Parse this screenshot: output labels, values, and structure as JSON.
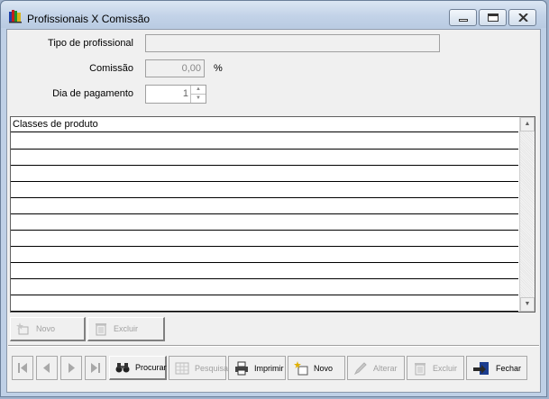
{
  "window": {
    "title": "Profissionais X Comissão",
    "controls": [
      "minimize",
      "maximize",
      "close"
    ]
  },
  "form": {
    "tipo_label": "Tipo de profissional",
    "tipo_value": "",
    "comissao_label": "Comissão",
    "comissao_value": "0,00",
    "comissao_unit": "%",
    "dia_label": "Dia de pagamento",
    "dia_value": "1"
  },
  "grid": {
    "header": "Classes de produto",
    "rows": [
      "",
      "",
      "",
      "",
      "",
      "",
      "",
      "",
      "",
      "",
      ""
    ]
  },
  "grid_buttons": {
    "novo": "Novo",
    "excluir": "Excluir"
  },
  "toolbar": {
    "procurar": "Procurar",
    "pesquisa": "Pesquisa",
    "imprimir": "Imprimir",
    "novo": "Novo",
    "alterar": "Alterar",
    "excluir": "Excluir",
    "fechar": "Fechar"
  }
}
